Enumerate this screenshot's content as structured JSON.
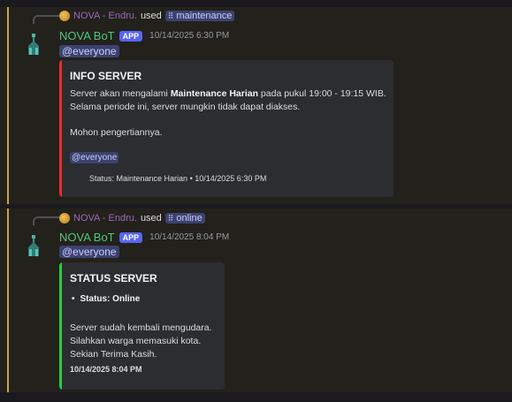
{
  "messages": [
    {
      "reply": {
        "name": "NOVA - Endru.",
        "used": "used",
        "command": "maintenance"
      },
      "author": "NOVA BoT",
      "badge": "APP",
      "timestamp": "10/14/2025 6:30 PM",
      "mention": "@everyone",
      "embed": {
        "color": "#e62e2e",
        "title": "INFO SERVER",
        "line1_pre": "Server akan mengalami ",
        "line1_bold": "Maintenance Harian",
        "line1_post": " pada pukul 19:00 - 19:15 WIB.",
        "line2": "Selama periode ini, server mungkin tidak dapat diakses.",
        "line3": "Mohon pengertiannya.",
        "mention": "@everyone",
        "footer_text": "Status: Maintenance Harian",
        "footer_sep": "•",
        "footer_time": "10/14/2025 6:30 PM"
      }
    },
    {
      "reply": {
        "name": "NOVA - Endru.",
        "used": "used",
        "command": "online"
      },
      "author": "NOVA BoT",
      "badge": "APP",
      "timestamp": "10/14/2025 8:04 PM",
      "mention": "@everyone",
      "embed": {
        "color": "#2ecc40",
        "title": "STATUS SERVER",
        "field": "Status: Online",
        "line1": "Server sudah kembali mengudara.",
        "line2": "Silahkan warga memasuki kota.",
        "line3": "Sekian Terima Kasih.",
        "footer_time": "10/14/2025 8:04 PM"
      }
    }
  ]
}
